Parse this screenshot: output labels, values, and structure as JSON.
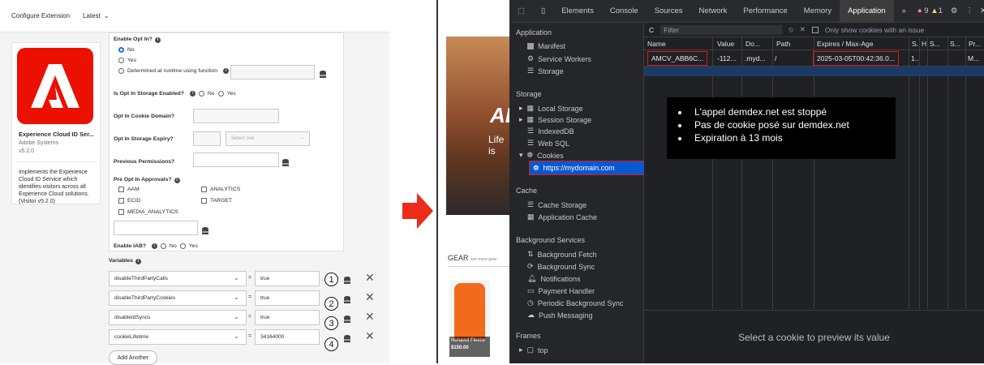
{
  "left": {
    "header": {
      "title": "Configure Extension",
      "version": "Latest"
    },
    "extension": {
      "name": "Experience Cloud ID Ser...",
      "vendor": "Adobe Systems",
      "version": "v5.2.0",
      "description": "Implements the Experience Cloud ID Service which identifies visitors across all Experience Cloud solutions. (Visitor v5.2.0)"
    },
    "form": {
      "enable_opt_in": {
        "label": "Enable Opt In?",
        "options": [
          "No",
          "Yes",
          "Determined at runtime using function"
        ],
        "selected": "No"
      },
      "opt_in_storage": {
        "label": "Is Opt In Storage Enabled?",
        "options": [
          "No",
          "Yes"
        ]
      },
      "cookie_domain": {
        "label": "Opt In Cookie Domain?"
      },
      "storage_expiry": {
        "label": "Opt In Storage Expiry?",
        "select_placeholder": "Select one"
      },
      "previous_permissions": {
        "label": "Previous Permissions?"
      },
      "pre_approvals": {
        "label": "Pre Opt In Approvals?",
        "checkboxes": [
          "AAM",
          "ANALYTICS",
          "ECID",
          "TARGET",
          "MEDIA_ANALYTICS"
        ]
      },
      "enable_iab": {
        "label": "Enable IAB?",
        "options": [
          "No",
          "Yes"
        ]
      }
    },
    "variables": {
      "label": "Variables",
      "rows": [
        {
          "name": "disableThirdPartyCalls",
          "value": "true",
          "marker": "1"
        },
        {
          "name": "disableThirdPartyCookies",
          "value": "true",
          "marker": "2"
        },
        {
          "name": "disableIdSyncs",
          "value": "true",
          "marker": "3"
        },
        {
          "name": "cookieLifetime",
          "value": "34164000",
          "marker": "4"
        }
      ],
      "add_label": "Add Another"
    }
  },
  "site": {
    "hero_text_1": "AD",
    "hero_text_2": "Life is",
    "gear_label": "GEAR",
    "gear_more": "see more gear",
    "product_name": "Nunavut Fleece",
    "product_price": "$150.00"
  },
  "devtools": {
    "tabs": [
      "Elements",
      "Console",
      "Sources",
      "Network",
      "Performance",
      "Memory",
      "Application",
      "»"
    ],
    "active_tab": "Application",
    "badges": {
      "errors": "9",
      "warnings": "1"
    },
    "filter_placeholder": "Filter",
    "only_issues_label": "Only show cookies with an issue",
    "sidebar": {
      "application_header": "Application",
      "application_items": [
        "Manifest",
        "Service Workers",
        "Storage"
      ],
      "storage_header": "Storage",
      "storage_items": [
        "Local Storage",
        "Session Storage",
        "IndexedDB",
        "Web SQL",
        "Cookies"
      ],
      "cookie_domain": "https://mydomain.com",
      "cache_header": "Cache",
      "cache_items": [
        "Cache Storage",
        "Application Cache"
      ],
      "bg_header": "Background Services",
      "bg_items": [
        "Background Fetch",
        "Background Sync",
        "Notifications",
        "Payment Handler",
        "Periodic Background Sync",
        "Push Messaging"
      ],
      "frames_header": "Frames",
      "frames_item": "top"
    },
    "columns": [
      "Name",
      "Value",
      "Do...",
      "Path",
      "Expires / Max-Age",
      "S.",
      "H",
      "S...",
      "S...",
      "Pr..."
    ],
    "cookie_row": {
      "name": "AMCV_ABB6C...",
      "value": "-112...",
      "domain": ".myd...",
      "path": "/",
      "expires": "2025-03-05T00:42:36.0...",
      "size": "1..",
      "priority": "M..."
    },
    "preview_text": "Select a cookie to preview its value"
  },
  "annotation": {
    "bullets": [
      "L'appel demdex.net est stoppé",
      "Pas de cookie posé sur demdex.net",
      "Expiration à 13 mois"
    ]
  },
  "colors": {
    "adobe_red": "#eb1000",
    "highlight_red": "#d81b1b",
    "devtools_bg": "#202124"
  }
}
